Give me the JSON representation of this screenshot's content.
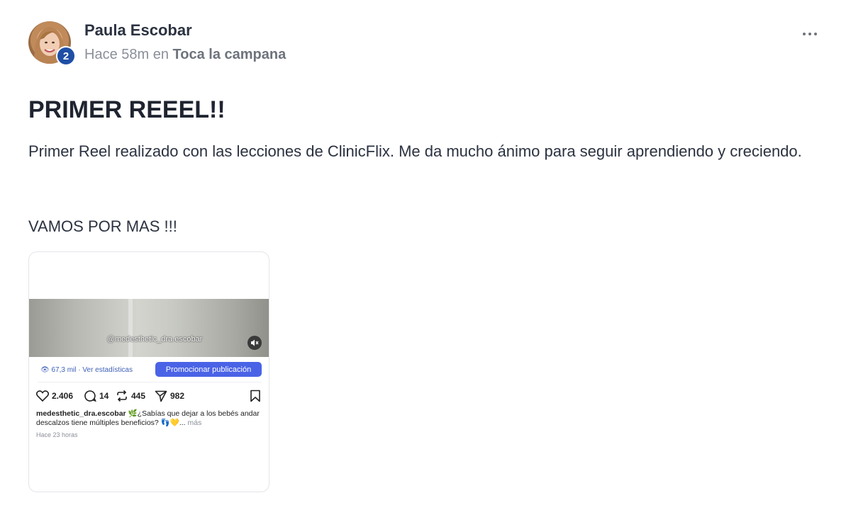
{
  "author": {
    "name": "Paula Escobar",
    "level": "2"
  },
  "meta": {
    "time": "Hace 58m",
    "in": "en",
    "category": "Toca la campana"
  },
  "post": {
    "title": "PRIMER REEEL!!",
    "body": "Primer Reel realizado con las lecciones de ClinicFlix. Me da mucho ánimo para seguir aprendiendo y creciendo.",
    "body2": "VAMOS POR MAS !!!"
  },
  "embed": {
    "video_handle": "@medesthetic_dra.escobar",
    "views": "67,3 mil · Ver estadísticas",
    "promote_label": "Promocionar publicación",
    "likes": "2.406",
    "comments": "14",
    "reposts": "445",
    "shares": "982",
    "caption_user": "medesthetic_dra.escobar",
    "caption_text": "🌿¿Sabías que dejar a los bebés andar descalzos tiene múltiples beneficios? 👣💛...",
    "caption_more": "más",
    "time_ago": "Hace 23 horas"
  },
  "colors": {
    "badge": "#1f4fa5",
    "promote": "#4a63e6",
    "views": "#3d5fb8"
  }
}
